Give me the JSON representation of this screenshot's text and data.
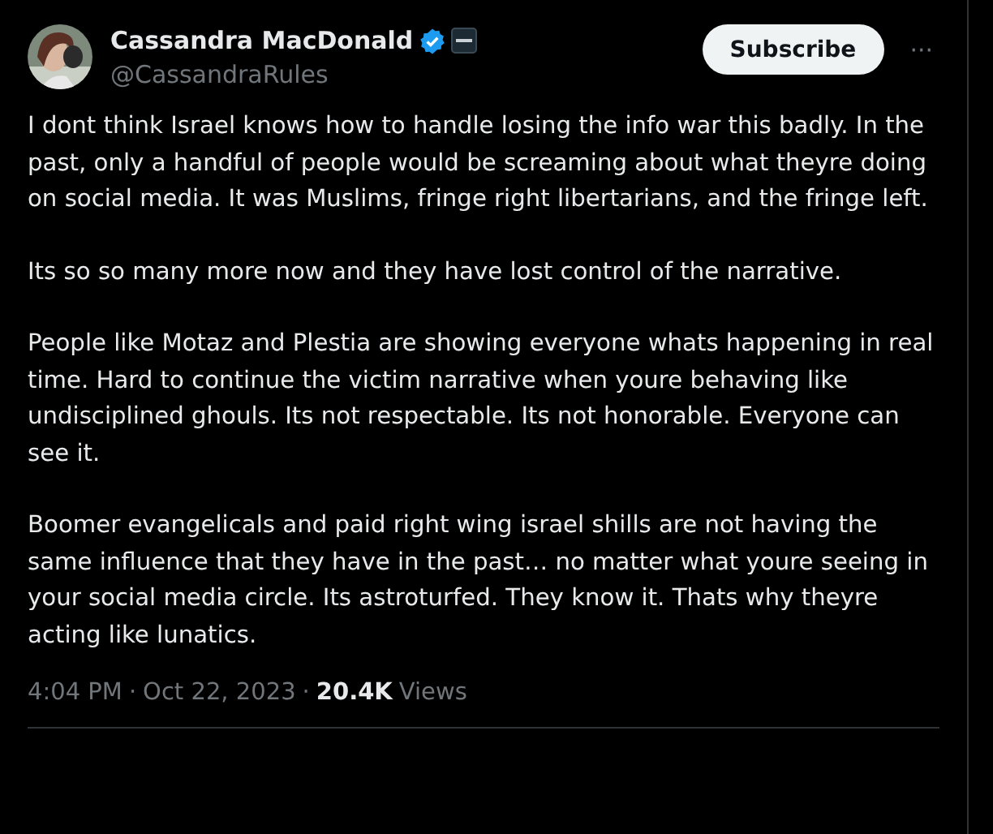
{
  "author": {
    "name": "Cassandra MacDonald",
    "verified": true,
    "handle": "@CassandraRules"
  },
  "subscribe_button": "Subscribe",
  "more_button": "···",
  "paragraphs": [
    "I dont think Israel knows how to handle losing the info war this badly. In the past, only a handful of people would be screaming about what theyre doing on social media. It was Muslims, fringe right libertarians, and the fringe left.",
    "Its so so many more now and they have lost control of the narrative.",
    "People like Motaz and Plestia are showing everyone whats happening in real time. Hard to continue the victim narrative when youre behaving like undisciplined ghouls. Its not respectable. Its not honorable. Everyone can see it.",
    "Boomer evangelicals and paid right wing israel shills are not having the same influence that they have in the past… no matter what youre seeing in your social media circle. Its astroturfed. They know it. Thats why theyre acting like lunatics."
  ],
  "meta": {
    "time": "4:04 PM",
    "separator_1": "·",
    "date": "Oct 22, 2023",
    "separator_2": "·",
    "views_count": "20.4K",
    "views_label": "Views"
  }
}
